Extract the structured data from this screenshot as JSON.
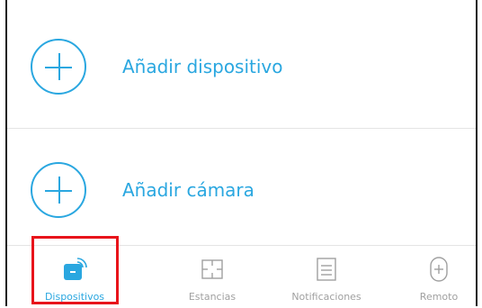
{
  "actions": [
    {
      "label": "Añadir dispositivo",
      "icon": "plus-circle-icon"
    },
    {
      "label": "Añadir cámara",
      "icon": "plus-circle-icon"
    }
  ],
  "tabs": [
    {
      "label": "Dispositivos",
      "icon": "device-wifi-icon",
      "active": true
    },
    {
      "label": "Estancias",
      "icon": "rooms-icon",
      "active": false
    },
    {
      "label": "Notificaciones",
      "icon": "notifications-icon",
      "active": false
    },
    {
      "label": "Remoto",
      "icon": "remote-plus-icon",
      "active": false
    }
  ],
  "colors": {
    "accent": "#2aa7e0",
    "inactive": "#a0a0a0",
    "highlight": "#e8141b",
    "divider": "#e4e4e4"
  }
}
